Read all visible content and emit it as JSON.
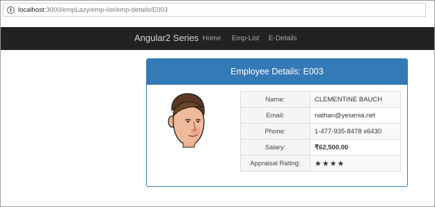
{
  "browser": {
    "url_host": "localhost",
    "url_path": ":3000/empLazy/emp-list/emp-details/E003"
  },
  "navbar": {
    "brand": "Angular2 Series",
    "links": [
      "Home",
      "Emp-List",
      "E-Details"
    ]
  },
  "panel": {
    "title": "Employee Details: E003",
    "avatar_icon": "employee-avatar-icon",
    "rows": [
      {
        "label": "Name:",
        "value": "CLEMENTINE BAUCH"
      },
      {
        "label": "Email:",
        "value": "nathan@yesenia.net"
      },
      {
        "label": "Phone:",
        "value": "1-477-935-8478 x6430"
      },
      {
        "label": "Salary:",
        "value": "₹62,500.00"
      },
      {
        "label": "Appraisal Rating:",
        "value": "★★★★"
      }
    ],
    "rating_stars": 4
  },
  "colors": {
    "navbar": "#222222",
    "panel_primary": "#337ab7",
    "salary": "#7b2a2a"
  }
}
